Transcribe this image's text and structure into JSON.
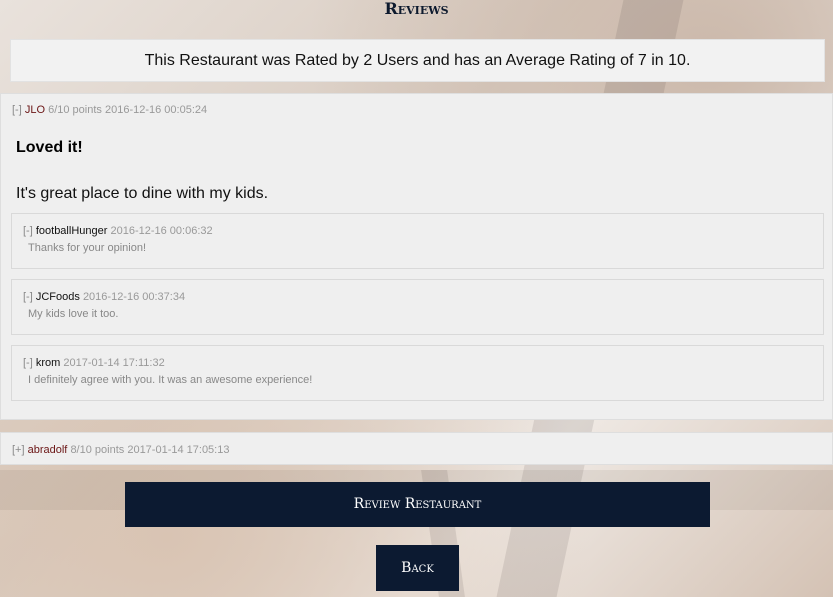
{
  "page": {
    "heading": "Reviews"
  },
  "summary": {
    "text": "This Restaurant was Rated by 2 Users and has an Average Rating of 7 in 10."
  },
  "reviews": [
    {
      "toggle": "[-]",
      "user": "JLO",
      "points": "6/10 points",
      "timestamp": "2016-12-16 00:05:24",
      "title": "Loved it!",
      "body": "It's great place to dine with my kids.",
      "replies": [
        {
          "toggle": "[-]",
          "user": "footballHunger",
          "timestamp": "2016-12-16 00:06:32",
          "text": "Thanks for your opinion!"
        },
        {
          "toggle": "[-]",
          "user": "JCFoods",
          "timestamp": "2016-12-16 00:37:34",
          "text": "My kids love it too."
        },
        {
          "toggle": "[-]",
          "user": "krom",
          "timestamp": "2017-01-14 17:11:32",
          "text": "I definitely agree with you. It was an awesome experience!"
        }
      ]
    },
    {
      "toggle": "[+]",
      "user": "abradolf",
      "points": "8/10 points",
      "timestamp": "2017-01-14 17:05:13"
    }
  ],
  "actions": {
    "review_label": "Review Restaurant",
    "back_label": "Back"
  },
  "colors": {
    "button_bg": "#0c1a31",
    "username": "#6b1515",
    "panel_bg": "#efefef"
  }
}
